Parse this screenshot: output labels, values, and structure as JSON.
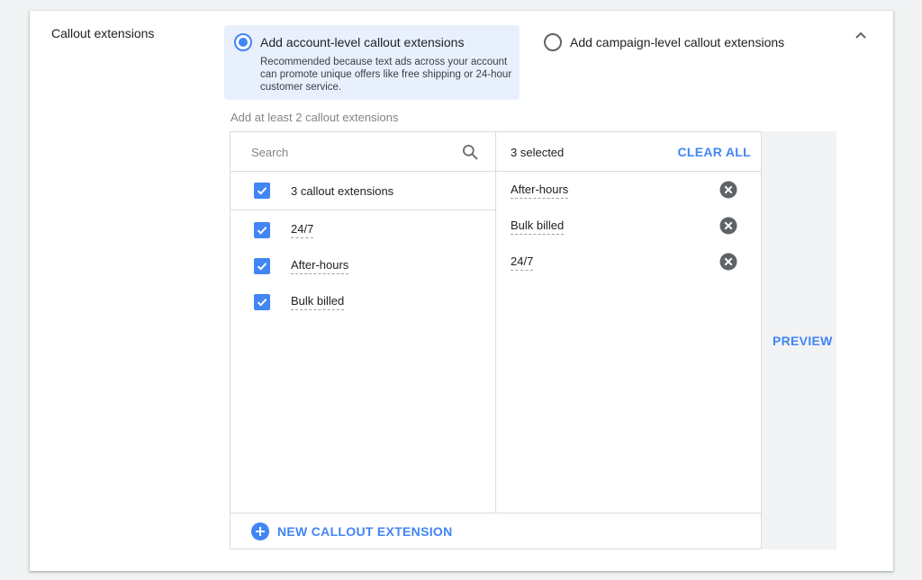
{
  "section": {
    "title": "Callout extensions"
  },
  "options": {
    "account": {
      "label": "Add account-level callout extensions",
      "description": "Recommended because text ads across your account can promote unique offers like free shipping or 24-hour customer service.",
      "selected": true
    },
    "campaign": {
      "label": "Add campaign-level callout extensions",
      "selected": false
    }
  },
  "hint": "Add at least 2 callout extensions",
  "search": {
    "placeholder": "Search",
    "value": ""
  },
  "available": {
    "select_all_label": "3 callout extensions",
    "items": [
      {
        "label": "24/7",
        "checked": true
      },
      {
        "label": "After-hours",
        "checked": true
      },
      {
        "label": "Bulk billed",
        "checked": true
      }
    ]
  },
  "selected": {
    "count_label": "3 selected",
    "clear_all_label": "CLEAR ALL",
    "items": [
      {
        "label": "After-hours"
      },
      {
        "label": "Bulk billed"
      },
      {
        "label": "24/7"
      }
    ]
  },
  "footer": {
    "new_button_label": "NEW CALLOUT EXTENSION"
  },
  "preview": {
    "label": "PREVIEW"
  },
  "colors": {
    "accent": "#4285f4",
    "selected_option_bg": "#e8f0fe",
    "remove_icon": "#5f6368"
  },
  "icons": {
    "collapse": "chevron-up-icon",
    "search": "search-icon",
    "checkbox": "check-icon",
    "remove": "cancel-circle-icon",
    "add": "add-circle-icon"
  }
}
